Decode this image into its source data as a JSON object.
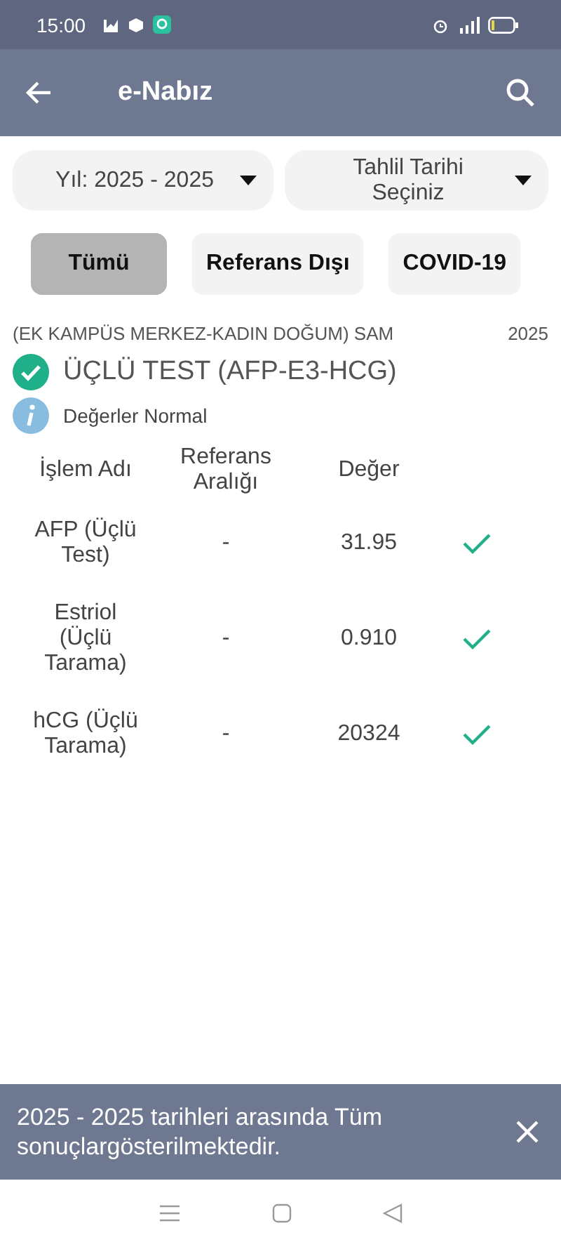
{
  "status_bar": {
    "time": "15:00"
  },
  "app_bar": {
    "title": "e-Nabız"
  },
  "filters": [
    {
      "label": "Yıl: 2025 - 2025"
    },
    {
      "label": "Tahlil Tarihi Seçiniz"
    }
  ],
  "tabs": [
    {
      "label": "Tümü",
      "selected": true
    },
    {
      "label": "Referans Dışı",
      "selected": false
    },
    {
      "label": "COVID-19",
      "selected": false
    }
  ],
  "result": {
    "hospital": "(EK KAMPÜS MERKEZ-KADIN DOĞUM) SAM",
    "date": "2025",
    "title": "ÜÇLÜ TEST (AFP-E3-HCG)",
    "normal": true,
    "note": "Değerler Normal"
  },
  "table": {
    "columns": [
      "İşlem Adı",
      "Referans Aralığı",
      "Değer"
    ],
    "rows": [
      {
        "name": "AFP (Üçlü Test)",
        "range": "-",
        "value": "31.95",
        "normal": true
      },
      {
        "name": "Estriol (Üçlü Tarama)",
        "range": "-",
        "value": "0.910",
        "normal": true
      },
      {
        "name": "hCG (Üçlü Tarama)",
        "range": "-",
        "value": "20324",
        "normal": true
      }
    ]
  },
  "snackbar": {
    "text": "2025 - 2025 tarihleri arasında Tüm sonuçlargösterilmektedir."
  }
}
